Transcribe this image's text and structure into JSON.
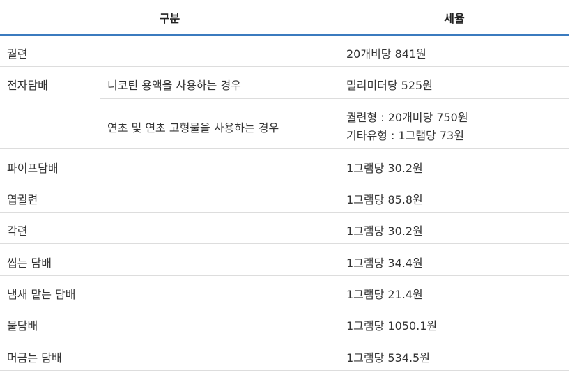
{
  "header": {
    "category": "구분",
    "tax_rate": "세율"
  },
  "rows": [
    {
      "category": "궐련",
      "sub": "",
      "rate": [
        "20개비당 841원"
      ]
    },
    {
      "category": "전자담배",
      "sub": "니코틴 용액을 사용하는 경우",
      "rate": [
        "밀리미터당 525원"
      ]
    },
    {
      "category": "",
      "sub": "연초 및 연초 고형물을 사용하는 경우",
      "rate": [
        "궐련형 : 20개비당 750원",
        "기타유형 : 1그램당 73원"
      ]
    },
    {
      "category": "파이프담배",
      "sub": "",
      "rate": [
        "1그램당 30.2원"
      ]
    },
    {
      "category": "엽궐련",
      "sub": "",
      "rate": [
        "1그램당 85.8원"
      ]
    },
    {
      "category": "각련",
      "sub": "",
      "rate": [
        "1그램당 30.2원"
      ]
    },
    {
      "category": "씹는 담배",
      "sub": "",
      "rate": [
        "1그램당 34.4원"
      ]
    },
    {
      "category": "냄새 맡는 담배",
      "sub": "",
      "rate": [
        "1그램당 21.4원"
      ]
    },
    {
      "category": "물담배",
      "sub": "",
      "rate": [
        "1그램당 1050.1원"
      ]
    },
    {
      "category": "머금는 담배",
      "sub": "",
      "rate": [
        "1그램당 534.5원"
      ]
    }
  ],
  "colors": {
    "header_border": "#3b7bbf",
    "row_border": "#dddddd"
  }
}
